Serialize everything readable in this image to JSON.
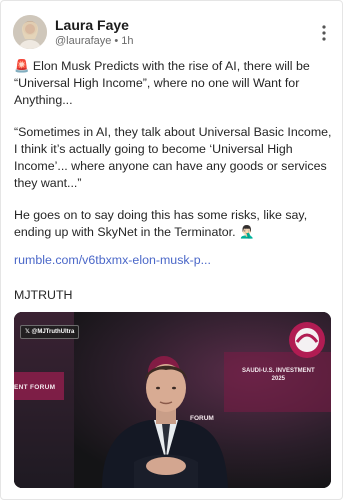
{
  "post": {
    "author_name": "Laura Faye",
    "author_handle": "@laurafaye",
    "separator": "•",
    "time": "1h",
    "alert_icon": "🚨",
    "paragraph1": " Elon Musk Predicts with the rise of AI, there will be “Universal High Income”, where no one will Want for Anything...",
    "paragraph2": "“Sometimes in AI, they talk about Universal Basic Income, I think it’s actually going to become ‘Universal High Income’... where anyone can have any goods or services they want...”",
    "paragraph3": "He goes on to say doing this has some risks, like say, ending up with SkyNet in the Terminator. 🤦🏻‍♂️",
    "link_text": "rumble.com/v6tbxmx-elon-musk-p...",
    "signature": "MJTRUTH"
  },
  "media": {
    "watermark": "𝕏 @MJTruthUltra",
    "forum_left": "ENT FORUM",
    "forum_right_line1": "SAUDI-U.S. INVESTMENT",
    "forum_right_line2": "2025",
    "forum_mid": "FORUM"
  },
  "colors": {
    "link": "#4a67c8",
    "stage_accent": "#c2185b"
  }
}
